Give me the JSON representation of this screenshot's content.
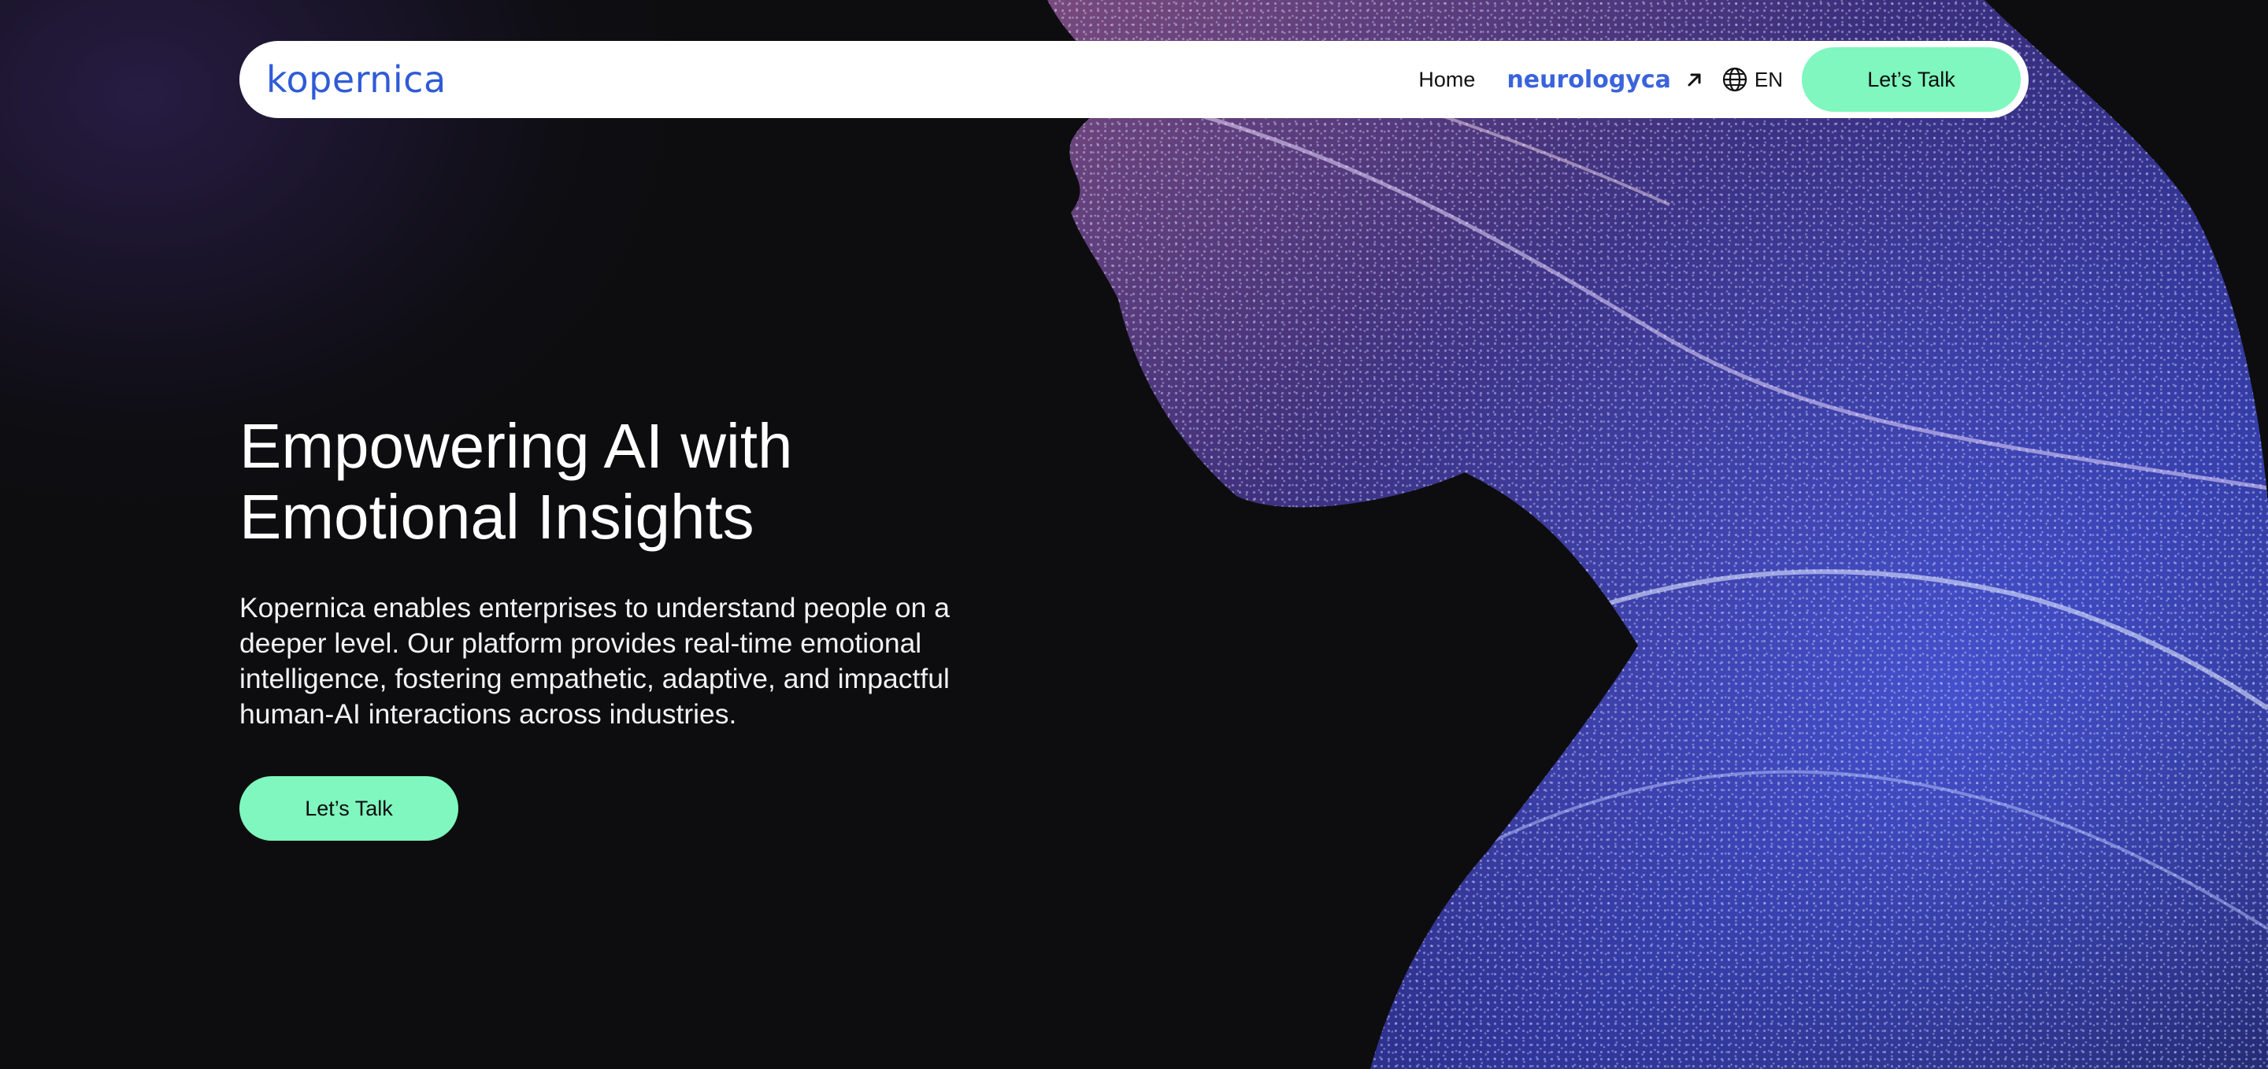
{
  "navbar": {
    "logo_text": "kopernica",
    "home_label": "Home",
    "partner_brand": "neurologyca",
    "language": "EN",
    "cta_label": "Let’s Talk"
  },
  "hero": {
    "title_line1": "Empowering AI with",
    "title_line2": "Emotional Insights",
    "description": "Kopernica enables enterprises to understand people on a deeper level. Our platform provides real-time emotional intelligence, fostering empathetic, adaptive, and impactful human-AI interactions across industries.",
    "cta_label": "Let’s Talk"
  },
  "icons": {
    "external_link": "arrow-up-right-icon",
    "language": "globe-icon"
  },
  "colors": {
    "background": "#0d0d0f",
    "accent": "#7ff7be",
    "brand_blue": "#2f5bd6",
    "navbar_bg": "#ffffff",
    "text_light": "#ffffff"
  }
}
